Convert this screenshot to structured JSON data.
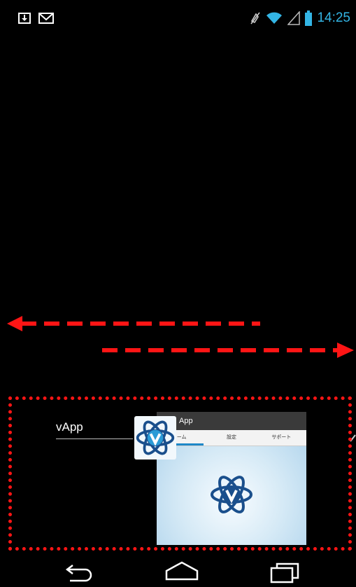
{
  "status_bar": {
    "time": "14:25",
    "icons": [
      "download-notification-icon",
      "gmail-icon",
      "mute-icon",
      "wifi-icon",
      "cell-signal-icon",
      "battery-icon"
    ]
  },
  "recents": {
    "app_name": "vApp",
    "thumbnail": {
      "title": "App",
      "tabs": [
        "ーム",
        "設定",
        "サポート"
      ],
      "active_tab_index": 0
    }
  },
  "nav_bar": {
    "buttons": [
      "back-icon",
      "home-icon",
      "recent-apps-icon"
    ]
  },
  "colors": {
    "accent_clock": "#33b5e5",
    "annotation_red": "#ff1515",
    "logo_blue": "#1a4f8c",
    "logo_light": "#2b9bd6"
  }
}
